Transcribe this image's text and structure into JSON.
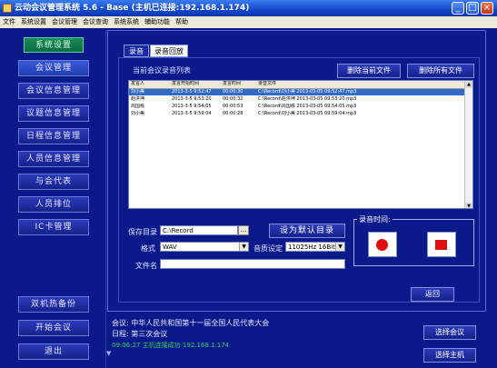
{
  "window": {
    "title": "云动会议管理系统 5.6 - Base (主机已连接:192.168.1.174)",
    "minimize": "_",
    "maximize": "□",
    "close": "×"
  },
  "menu": [
    "文件",
    "系统设置",
    "会议管理",
    "会议查询",
    "系统系统",
    "辅助功能",
    "帮助"
  ],
  "sidebar": {
    "system_settings": "系统设置",
    "items": [
      "会议管理",
      "会议信息管理",
      "议题信息管理",
      "日程信息管理",
      "人员信息管理",
      "与会代表",
      "人员排位",
      "IC卡管理"
    ],
    "backup": "双机热备份",
    "start_meeting": "开始会议",
    "exit": "退出"
  },
  "tabs": {
    "record": "录音",
    "record_files": "录音回放"
  },
  "list": {
    "title": "当前会议录音列表",
    "delete_current": "删除当前文件",
    "delete_all": "删除所有文件",
    "columns": [
      "发言人",
      "发言开始时间",
      "发言时间",
      "录音文件"
    ],
    "rows": [
      [
        "刘小美",
        "2013-3-5 9:52:47",
        "00:00:30",
        "C:\\Record\\刘小美 2013-03-05 09:52:47.mp3"
      ],
      [
        "赵洪坤",
        "2013-3-5 9:53:20",
        "00:00:32",
        "C:\\Record\\赵洪坤 2013-03-05 09:53:20.mp3"
      ],
      [
        "周国栋",
        "2013-3-5 9:54:05",
        "00:00:53",
        "C:\\Record\\周国栋 2013-03-05 09:54:05.mp3"
      ],
      [
        "刘小美",
        "2013-3-5 9:59:04",
        "00:00:28",
        "C:\\Record\\刘小美 2013-03-05 09:59:04.mp3"
      ]
    ],
    "selected_index": 0
  },
  "form": {
    "save_dir_label": "保存目录",
    "save_dir_value": "C:\\Record",
    "browse": "...",
    "set_default": "设为默认目录",
    "format_label": "格式",
    "format_value": "WAV",
    "audio_setting_label": "音质设定",
    "audio_setting_value": "11025Hz 16Bit",
    "filename_label": "文件名",
    "filename_value": ""
  },
  "recording": {
    "label": "录音时间:"
  },
  "back_button": "返回",
  "footer": {
    "meeting": "会议: 中华人民共和国第十一届全国人民代表大会",
    "agenda": "日程: 第三次会议",
    "status": "09:06:27 主机连接成功 192.168.1.174",
    "select_meeting": "选择会议",
    "select_host": "选择主机"
  },
  "colors": {
    "background": "#0a1a8a",
    "record_red": "#e01010",
    "status_green": "#30d060"
  }
}
